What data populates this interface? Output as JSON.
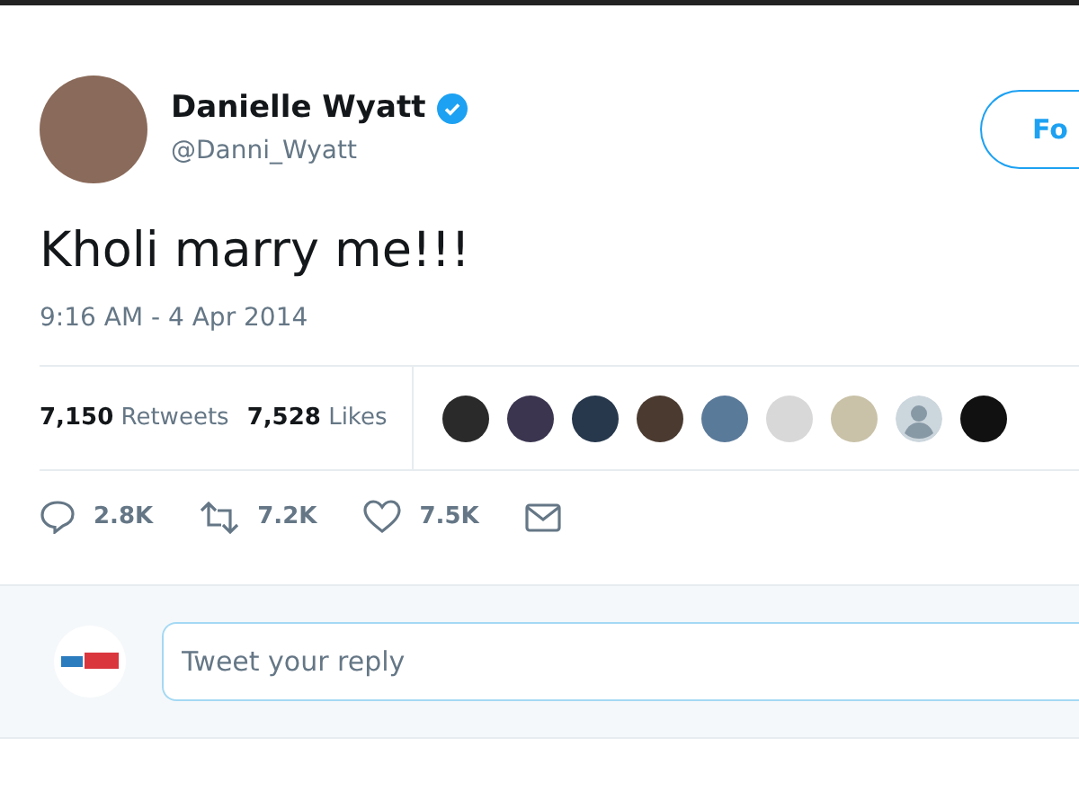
{
  "author": {
    "name": "Danielle Wyatt",
    "verified": true,
    "handle": "@Danni_Wyatt"
  },
  "follow_button": {
    "label": "Fo"
  },
  "tweet": {
    "text": "Kholi marry me!!!",
    "timestamp": "9:16 AM - 4 Apr 2014"
  },
  "stats": [
    {
      "count": "7,150",
      "label": "Retweets"
    },
    {
      "count": "7,528",
      "label": "Likes"
    }
  ],
  "liker_avatars": [
    {
      "kind": "photo"
    },
    {
      "kind": "photo"
    },
    {
      "kind": "photo"
    },
    {
      "kind": "photo"
    },
    {
      "kind": "photo"
    },
    {
      "kind": "photo"
    },
    {
      "kind": "photo"
    },
    {
      "kind": "default"
    },
    {
      "kind": "photo"
    }
  ],
  "actions": [
    {
      "kind": "reply",
      "count": "2.8K"
    },
    {
      "kind": "retweet",
      "count": "7.2K"
    },
    {
      "kind": "like",
      "count": "7.5K"
    },
    {
      "kind": "message"
    }
  ],
  "reply_box": {
    "placeholder": "Tweet your reply"
  }
}
